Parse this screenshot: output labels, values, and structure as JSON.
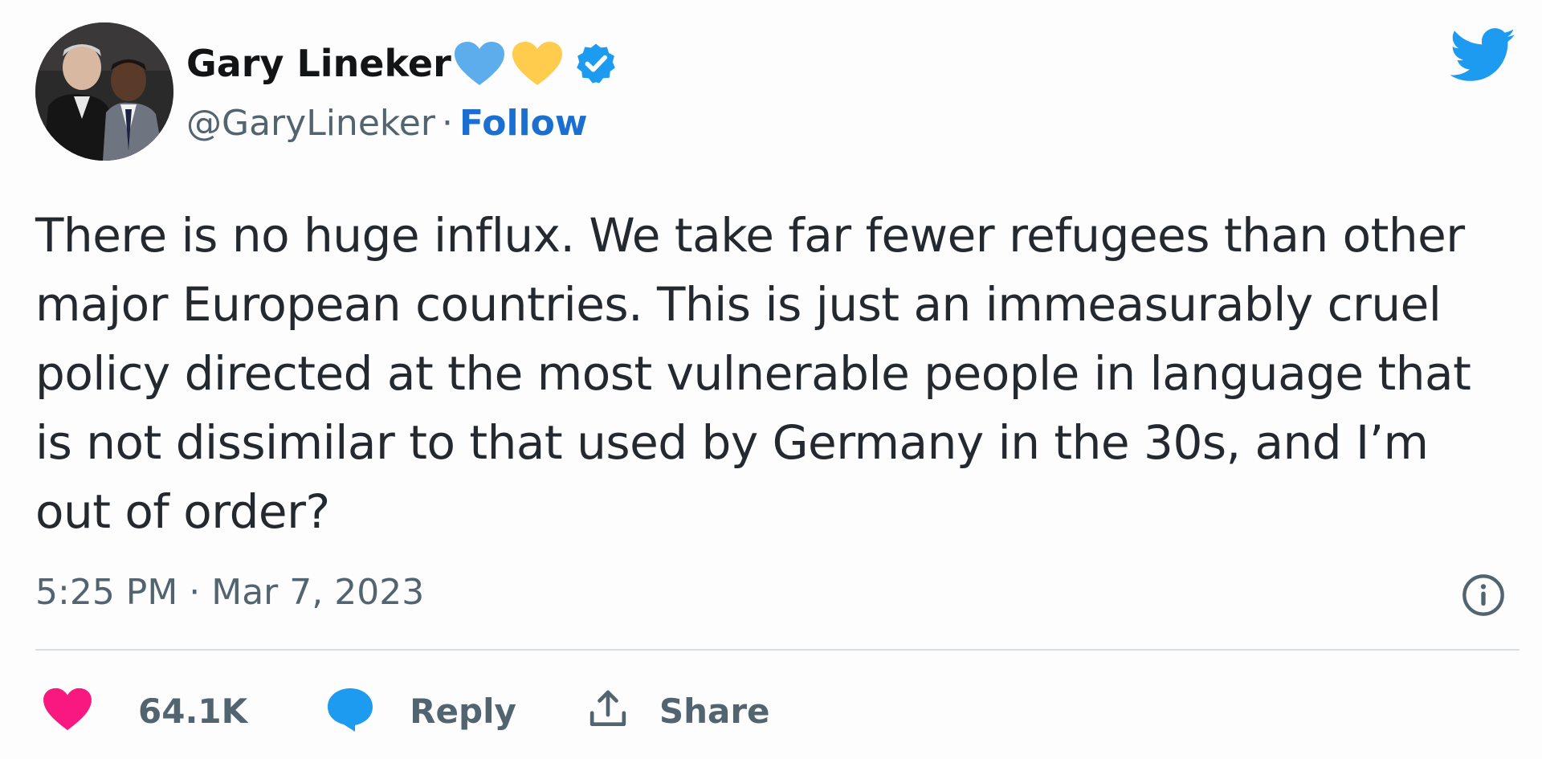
{
  "author": {
    "display_name": "Gary Lineker",
    "handle": "@GaryLineker",
    "separator": "·",
    "follow_label": "Follow",
    "verified": true,
    "name_emojis": [
      "blue-heart-icon",
      "yellow-heart-icon"
    ]
  },
  "tweet": {
    "text": "There is no huge influx. We take far fewer refugees than other major European countries. This is just an immeasurably cruel policy directed at the most vulnerable people in language that is not dissimilar to that used by Germany in the 30s, and I’m out of order?",
    "timestamp": "5:25 PM · Mar 7, 2023"
  },
  "actions": {
    "like_count": "64.1K",
    "reply_label": "Reply",
    "share_label": "Share"
  },
  "colors": {
    "twitter_blue": "#1d9bf0",
    "follow_blue": "#1a6fd1",
    "like_pink": "#f91880",
    "heart_blue": "#5dadec",
    "heart_yellow": "#ffcc4d",
    "muted_gray": "#536471"
  },
  "icons": {
    "brand": "twitter-bird-icon",
    "verified": "verified-badge-icon",
    "info": "info-icon",
    "like": "heart-icon",
    "reply": "speech-bubble-icon",
    "share": "share-upload-icon"
  }
}
